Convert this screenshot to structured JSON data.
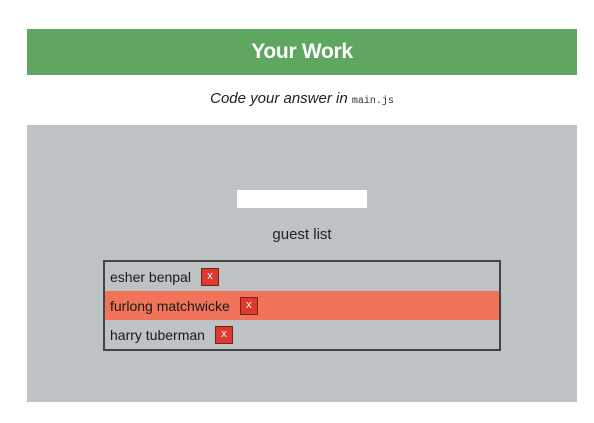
{
  "header": {
    "title": "Your Work"
  },
  "instruction": {
    "text": "Code your answer in",
    "filename": "main.js"
  },
  "form": {
    "input_value": "",
    "input_placeholder": ""
  },
  "guest_list": {
    "title": "guest list",
    "items": [
      {
        "name": "esher benpal",
        "remove_label": "x",
        "highlighted": false
      },
      {
        "name": "furlong matchwicke",
        "remove_label": "x",
        "highlighted": true
      },
      {
        "name": "harry tuberman",
        "remove_label": "x",
        "highlighted": false
      }
    ]
  },
  "colors": {
    "header_bg": "#5fa760",
    "panel_bg": "#bdc2c5",
    "highlight_bg": "#f0735a",
    "remove_button_bg": "#dd3a2e"
  }
}
